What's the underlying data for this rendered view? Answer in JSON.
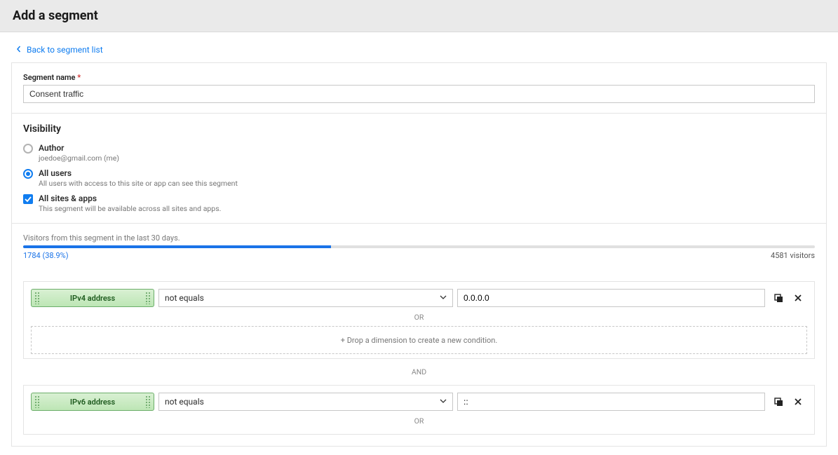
{
  "header": {
    "title": "Add a segment"
  },
  "back_link": "Back to segment list",
  "segment_name": {
    "label": "Segment name",
    "value": "Consent traffic"
  },
  "visibility": {
    "title": "Visibility",
    "options": [
      {
        "label": "Author",
        "sub": "joedoe@gmail.com (me)"
      },
      {
        "label": "All users",
        "sub": "All users with access to this site or app can see this segment"
      }
    ],
    "check": {
      "label": "All sites & apps",
      "sub": "This segment will be available across all sites and apps."
    }
  },
  "stats": {
    "label": "Visitors from this segment in the last 30 days.",
    "left": "1784 (38.9%)",
    "right": "4581 visitors",
    "percent": 38.9
  },
  "cond": {
    "groups": [
      {
        "dim": "IPv4 address",
        "op": "not equals",
        "val": "0.0.0.0",
        "or": "OR",
        "drop": "+ Drop a dimension to create a new condition."
      },
      {
        "dim": "IPv6 address",
        "op": "not equals",
        "val": "::",
        "or": "OR"
      }
    ],
    "and": "AND"
  }
}
